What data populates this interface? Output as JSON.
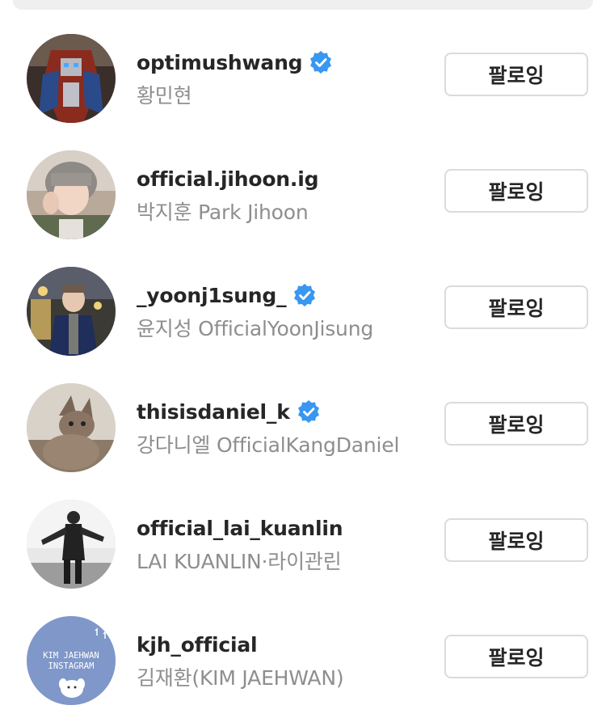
{
  "accent_color": "#3897f0",
  "follow_button_label": "팔로잉",
  "users": [
    {
      "username": "optimushwang",
      "full_name": "황민현",
      "verified": true,
      "avatar": "transformer-robot-avatar"
    },
    {
      "username": "official.jihoon.ig",
      "full_name": "박지훈 Park Jihoon",
      "verified": false,
      "avatar": "person-portrait-avatar"
    },
    {
      "username": "_yoonj1sung_",
      "full_name": "윤지성 OfficialYoonJisung",
      "verified": true,
      "avatar": "person-night-street-avatar"
    },
    {
      "username": "thisisdaniel_k",
      "full_name": "강다니엘 OfficialKangDaniel",
      "verified": true,
      "avatar": "cat-avatar"
    },
    {
      "username": "official_lai_kuanlin",
      "full_name": "LAI KUANLIN·라이관린",
      "verified": false,
      "avatar": "bw-person-avatar"
    },
    {
      "username": "kjh_official",
      "full_name": "김재환(KIM JAEHWAN)",
      "verified": false,
      "avatar": "kim-jaehwan-instagram-logo",
      "avatar_text": [
        "KIM JAEHWAN",
        "INSTAGRAM"
      ]
    }
  ]
}
